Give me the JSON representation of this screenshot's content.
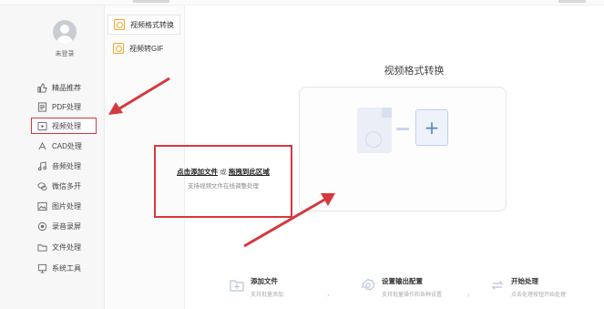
{
  "sidebar": {
    "user": {
      "login_label": "未登录"
    },
    "items": [
      {
        "label": "精品推荐",
        "icon": "thumbs-up-icon"
      },
      {
        "label": "PDF处理",
        "icon": "pdf-icon"
      },
      {
        "label": "视频处理",
        "icon": "video-icon",
        "active": true
      },
      {
        "label": "CAD处理",
        "icon": "cad-icon"
      },
      {
        "label": "音频处理",
        "icon": "music-icon"
      },
      {
        "label": "微信多开",
        "icon": "wechat-icon"
      },
      {
        "label": "图片处理",
        "icon": "image-icon"
      },
      {
        "label": "录音录屏",
        "icon": "record-icon"
      },
      {
        "label": "文件处理",
        "icon": "folder-icon"
      },
      {
        "label": "系统工具",
        "icon": "system-tool-icon"
      }
    ]
  },
  "subnav": {
    "items": [
      {
        "label": "视频格式转换",
        "selected": true
      },
      {
        "label": "视频转GIF",
        "selected": false
      }
    ]
  },
  "main": {
    "title": "视频格式转换",
    "drop": {
      "plus_glyph": "+",
      "hint_add": "点击添加文件",
      "hint_or": "或",
      "hint_drag": "拖拽到此区域",
      "hint_sub": "支持视频文件在线调整处理"
    }
  },
  "steps": [
    {
      "title": "添加文件",
      "desc": "支持批量添加"
    },
    {
      "title": "设置输出配置",
      "desc": "支持批量操作和各种设置"
    },
    {
      "title": "开始处理",
      "desc": "点击处理按钮开始处理"
    }
  ],
  "steps_separator": "›",
  "colors": {
    "highlight_red": "#d5383f",
    "accent_blue": "#5b84c6",
    "icon_orange": "#f0a430"
  }
}
